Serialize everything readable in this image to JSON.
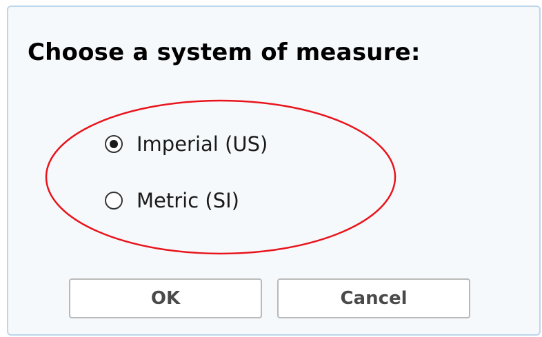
{
  "dialog": {
    "title": "Choose a system of measure:",
    "options": [
      {
        "label": "Imperial (US)",
        "selected": true
      },
      {
        "label": "Metric (SI)",
        "selected": false
      }
    ],
    "ok_label": "OK",
    "cancel_label": "Cancel"
  },
  "colors": {
    "highlight_ellipse": "#e8141c",
    "dialog_background": "#f6f9fb",
    "dialog_border": "#bcd6ea"
  },
  "icons": [
    "radio-selected-icon",
    "radio-unselected-icon"
  ]
}
